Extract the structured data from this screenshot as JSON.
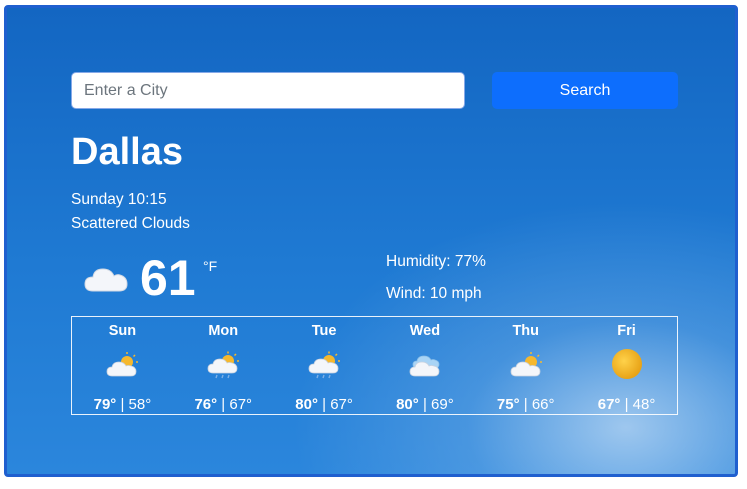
{
  "search": {
    "placeholder": "Enter a City",
    "value": "",
    "button_label": "Search"
  },
  "current": {
    "city": "Dallas",
    "datetime": "Sunday 10:15",
    "condition": "Scattered Clouds",
    "icon": "cloud-icon",
    "temperature": "61",
    "unit": "°F",
    "humidity": "Humidity: 77%",
    "wind": "Wind: 10 mph"
  },
  "forecast": [
    {
      "day": "Sun",
      "high": "79°",
      "low": "58°",
      "icon": "partly-sunny-icon"
    },
    {
      "day": "Mon",
      "high": "76°",
      "low": "67°",
      "icon": "partly-sunny-rain-icon"
    },
    {
      "day": "Tue",
      "high": "80°",
      "low": "67°",
      "icon": "partly-sunny-rain-icon"
    },
    {
      "day": "Wed",
      "high": "80°",
      "low": "69°",
      "icon": "rain-cloud-icon"
    },
    {
      "day": "Thu",
      "high": "75°",
      "low": "66°",
      "icon": "partly-sunny-icon"
    },
    {
      "day": "Fri",
      "high": "67°",
      "low": "48°",
      "icon": "sun-icon"
    }
  ],
  "colors": {
    "accent": "#0d6efd",
    "background": "#1a72cc"
  }
}
